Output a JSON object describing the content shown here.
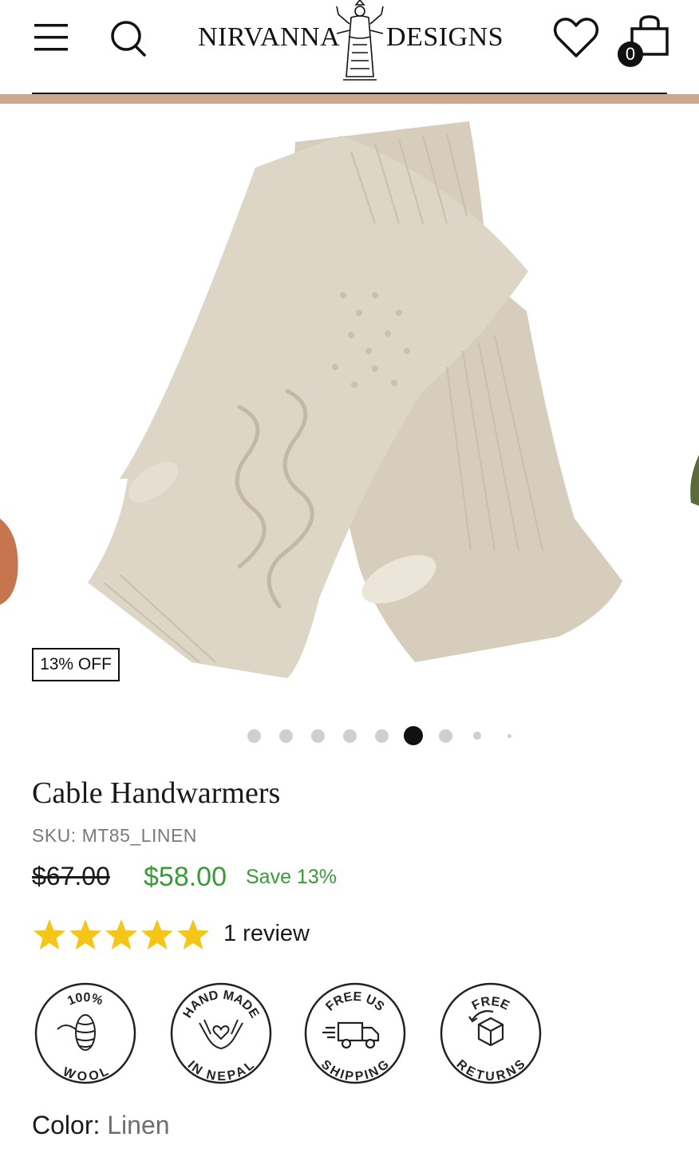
{
  "header": {
    "brand_left": "NIRVANNA",
    "brand_right": "DESIGNS",
    "cart_count": "0",
    "icons": [
      "menu-icon",
      "search-icon",
      "heart-icon",
      "shopping-bag-icon"
    ]
  },
  "gallery": {
    "badge": "13% OFF",
    "active_slide": 6,
    "slide_count": 9
  },
  "product": {
    "title": "Cable Handwarmers",
    "sku": "SKU: MT85_LINEN",
    "price_original": "$67.00",
    "price_sale": "$58.00",
    "save_text": "Save 13%",
    "rating": 5,
    "review_text": "1 review",
    "features": [
      {
        "top": "100%",
        "bottom": "WOOL"
      },
      {
        "top": "HAND MADE",
        "bottom": "IN NEPAL"
      },
      {
        "top": "FREE US",
        "bottom": "SHIPPING"
      },
      {
        "top": "FREE",
        "bottom": "RETURNS"
      }
    ],
    "color_label": "Color:",
    "color_value": "Linen"
  },
  "colors": {
    "accent_strip": "#c9a98f",
    "sale_green": "#3a9a3a",
    "star_yellow": "#f5c518",
    "glove": "#d8cfbf"
  }
}
